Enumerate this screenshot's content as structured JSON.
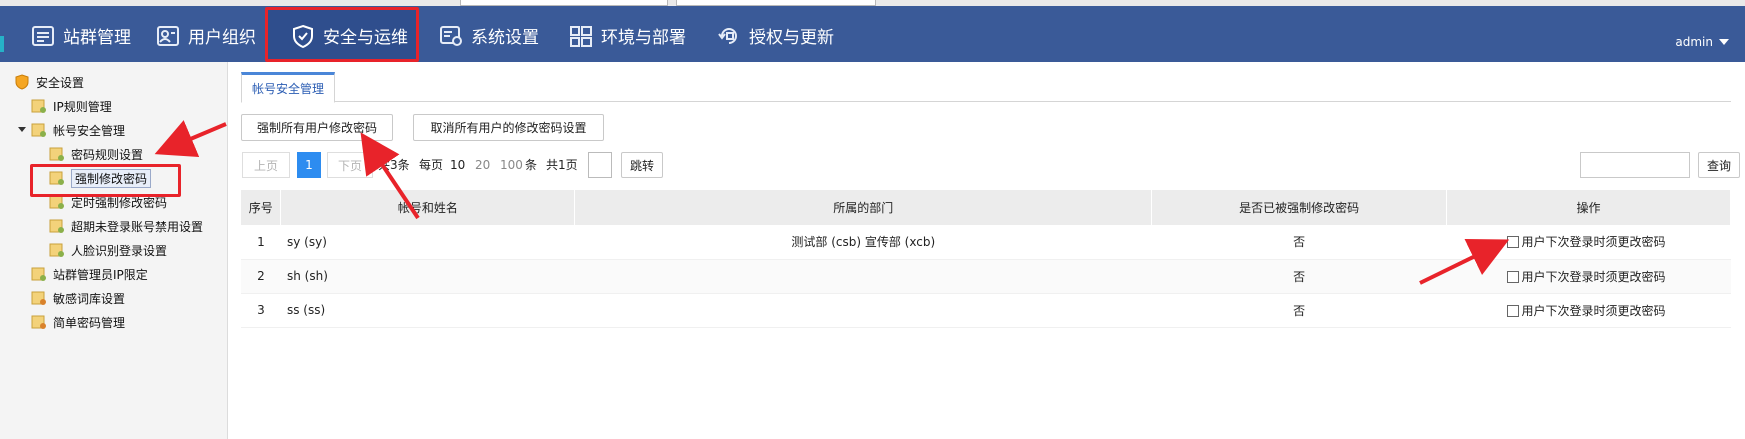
{
  "nav": {
    "items": [
      {
        "label": "站群管理",
        "icon": "site-group-icon"
      },
      {
        "label": "用户组织",
        "icon": "user-org-icon"
      },
      {
        "label": "安全与运维",
        "icon": "shield-check-icon"
      },
      {
        "label": "系统设置",
        "icon": "system-settings-icon"
      },
      {
        "label": "环境与部署",
        "icon": "environment-icon"
      },
      {
        "label": "授权与更新",
        "icon": "license-update-icon"
      }
    ],
    "active_index": 2,
    "user": "admin"
  },
  "sidebar": {
    "root": "安全设置",
    "items": [
      {
        "label": "IP规则管理",
        "level": 1
      },
      {
        "label": "帐号安全管理",
        "level": 1,
        "expanded": true
      },
      {
        "label": "密码规则设置",
        "level": 2
      },
      {
        "label": "强制修改密码",
        "level": 2,
        "selected": true
      },
      {
        "label": "定时强制修改密码",
        "level": 2
      },
      {
        "label": "超期未登录账号禁用设置",
        "level": 2
      },
      {
        "label": "人脸识别登录设置",
        "level": 2
      },
      {
        "label": "站群管理员IP限定",
        "level": 1
      },
      {
        "label": "敏感词库设置",
        "level": 1
      },
      {
        "label": "简单密码管理",
        "level": 1
      }
    ]
  },
  "main": {
    "tab": "帐号安全管理",
    "force_all_button": "强制所有用户修改密码",
    "cancel_all_button": "取消所有用户的修改密码设置",
    "pagination": {
      "prev": "上页",
      "current_page": "1",
      "next": "下页",
      "total": "共3条",
      "per_page_label": "每页",
      "size_10": "10",
      "size_20": "20",
      "size_100": "100",
      "unit": "条",
      "pages": "共1页",
      "jump": "跳转"
    },
    "search_button": "查询",
    "table": {
      "headers": [
        "序号",
        "帐号和姓名",
        "所属的部门",
        "是否已被强制修改密码",
        "操作"
      ],
      "rows": [
        {
          "no": "1",
          "account": "sy (sy)",
          "dept": "测试部 (csb) 宣传部 (xcb)",
          "forced": "否",
          "action": "用户下次登录时须更改密码"
        },
        {
          "no": "2",
          "account": "sh (sh)",
          "dept": "",
          "forced": "否",
          "action": "用户下次登录时须更改密码"
        },
        {
          "no": "3",
          "account": "ss (ss)",
          "dept": "",
          "forced": "否",
          "action": "用户下次登录时须更改密码"
        }
      ]
    }
  },
  "colors": {
    "nav_bg": "#3a5a98",
    "highlight": "#e8232a",
    "accent": "#2d8cf0"
  }
}
